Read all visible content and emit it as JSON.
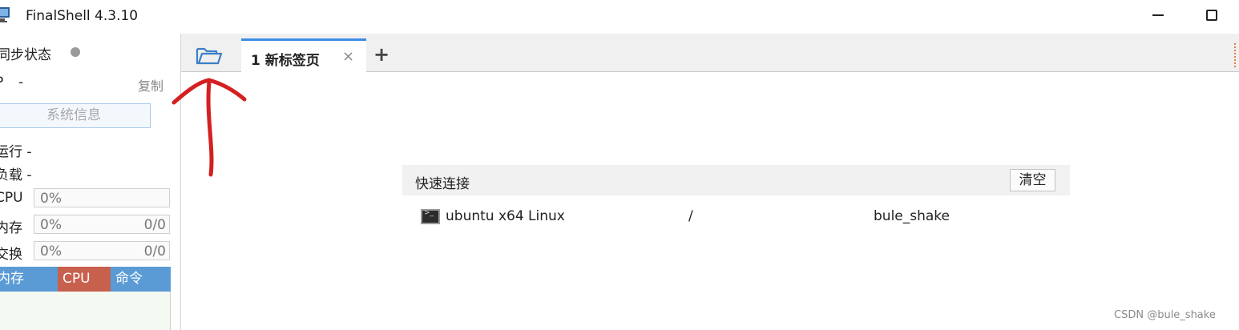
{
  "window": {
    "title": "FinalShell 4.3.10"
  },
  "left_panel": {
    "sync_label": "同步状态",
    "ip_label": "P",
    "ip_value": "-",
    "copy_label": "复制",
    "sysinfo_button": "系统信息",
    "running_label": "运行 -",
    "load_label": "负载 -",
    "meters": [
      {
        "label": "CPU",
        "percent": "0%",
        "ratio": ""
      },
      {
        "label": "内存",
        "percent": "0%",
        "ratio": "0/0"
      },
      {
        "label": "交换",
        "percent": "0%",
        "ratio": "0/0"
      }
    ],
    "process_headers": [
      "内存",
      "CPU",
      "命令"
    ]
  },
  "tabbar": {
    "folder_icon": "folder-open-icon",
    "active_tab": "1 新标签页",
    "close_glyph": "×",
    "add_glyph": "+"
  },
  "quick_connect": {
    "title": "快速连接",
    "clear_button": "清空",
    "rows": [
      {
        "name": "ubuntu x64 Linux",
        "path": "/",
        "user": "bule_shake",
        "icon": "terminal-icon"
      }
    ]
  },
  "watermark": "CSDN @bule_shake",
  "colors": {
    "accent": "#3d8be6",
    "process_header": "#5b9bd5",
    "cpu_header": "#c8604e",
    "annotation": "#d42020"
  }
}
